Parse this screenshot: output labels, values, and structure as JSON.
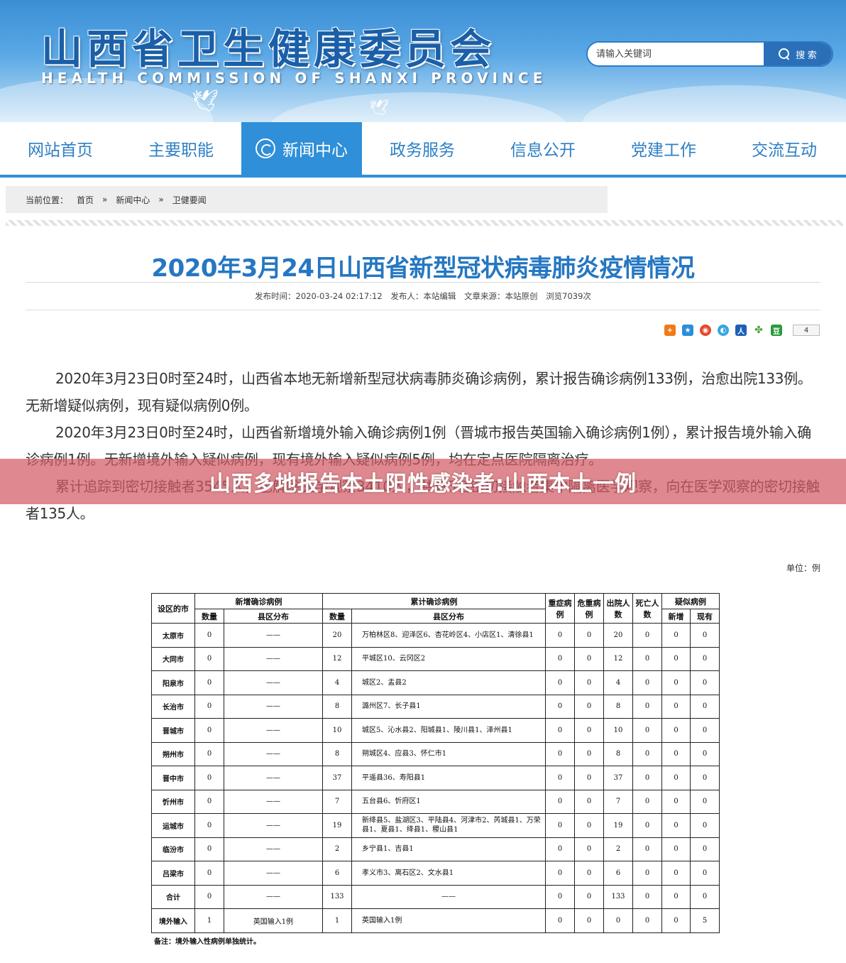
{
  "header": {
    "title": "山西省卫生健康委员会",
    "subtitle": "HEALTH COMMISSION OF SHANXI PROVINCE",
    "search_placeholder": "请输入关键词",
    "search_button": "搜 索"
  },
  "nav": [
    {
      "label": "网站首页",
      "active": false
    },
    {
      "label": "主要职能",
      "active": false
    },
    {
      "label": "新闻中心",
      "active": true
    },
    {
      "label": "政务服务",
      "active": false
    },
    {
      "label": "信息公开",
      "active": false
    },
    {
      "label": "党建工作",
      "active": false
    },
    {
      "label": "交流互动",
      "active": false
    }
  ],
  "breadcrumb": {
    "prefix": "当前位置：",
    "items": [
      "首页",
      "新闻中心",
      "卫健要闻"
    ],
    "sep": "»"
  },
  "article": {
    "title": "2020年3月24日山西省新型冠状病毒肺炎疫情情况",
    "meta": {
      "publish_time": "发布时间：2020-03-24 02:17:12",
      "publisher": "发布人：本站编辑",
      "source": "文章来源：本站原创",
      "views": "浏览7039次"
    },
    "share_count": "4",
    "paragraphs": [
      "2020年3月23日0时至24时，山西省本地无新增新型冠状病毒肺炎确诊病例，累计报告确诊病例133例，治愈出院133例。无新增疑似病例，现有疑似病例0例。",
      "2020年3月23日0时至24时，山西省新增境外输入确诊病例1例（晋城市报告英国输入确诊病例1例），累计报告境外输入确诊病例1例。无新增境外输入疑似病例，现有境外输入疑似病例5例，均在定点医院隔离治疗。",
      "累计追踪到密切接触者3545人，已解除医学观察3410人，共有3名密切接触者集中隔离医学观察，向在医学观察的密切接触者135人。"
    ],
    "unit": "单位：例"
  },
  "banner": "山西多地报告本土阳性感染者:山西本土一例",
  "table": {
    "headers": {
      "city": "设区的市",
      "new_group": "新增确诊病例",
      "cum_group": "累计确诊病例",
      "count": "数量",
      "dist": "县区分布",
      "severe": "重症病例",
      "critical": "危重病例",
      "discharged": "出院人数",
      "death": "死亡人数",
      "suspect_group": "疑似病例",
      "suspect_new": "新增",
      "suspect_now": "现有"
    },
    "rows": [
      {
        "city": "太原市",
        "new": "0",
        "new_dist": "——",
        "cum": "20",
        "cum_dist": "万柏林区8、迎泽区6、杏花岭区4、小店区1、清徐县1",
        "severe": "0",
        "critical": "0",
        "discharged": "20",
        "death": "0",
        "s_new": "0",
        "s_now": "0"
      },
      {
        "city": "大同市",
        "new": "0",
        "new_dist": "——",
        "cum": "12",
        "cum_dist": "平城区10、云冈区2",
        "severe": "0",
        "critical": "0",
        "discharged": "12",
        "death": "0",
        "s_new": "0",
        "s_now": "0"
      },
      {
        "city": "阳泉市",
        "new": "0",
        "new_dist": "——",
        "cum": "4",
        "cum_dist": "城区2、盂县2",
        "severe": "0",
        "critical": "0",
        "discharged": "4",
        "death": "0",
        "s_new": "0",
        "s_now": "0"
      },
      {
        "city": "长治市",
        "new": "0",
        "new_dist": "——",
        "cum": "8",
        "cum_dist": "潞州区7、长子县1",
        "severe": "0",
        "critical": "0",
        "discharged": "8",
        "death": "0",
        "s_new": "0",
        "s_now": "0"
      },
      {
        "city": "晋城市",
        "new": "0",
        "new_dist": "——",
        "cum": "10",
        "cum_dist": "城区5、沁水县2、阳城县1、陵川县1、泽州县1",
        "severe": "0",
        "critical": "0",
        "discharged": "10",
        "death": "0",
        "s_new": "0",
        "s_now": "0"
      },
      {
        "city": "朔州市",
        "new": "0",
        "new_dist": "——",
        "cum": "8",
        "cum_dist": "朔城区4、应县3、怀仁市1",
        "severe": "0",
        "critical": "0",
        "discharged": "8",
        "death": "0",
        "s_new": "0",
        "s_now": "0"
      },
      {
        "city": "晋中市",
        "new": "0",
        "new_dist": "——",
        "cum": "37",
        "cum_dist": "平遥县36、寿阳县1",
        "severe": "0",
        "critical": "0",
        "discharged": "37",
        "death": "0",
        "s_new": "0",
        "s_now": "0"
      },
      {
        "city": "忻州市",
        "new": "0",
        "new_dist": "——",
        "cum": "7",
        "cum_dist": "五台县6、忻府区1",
        "severe": "0",
        "critical": "0",
        "discharged": "7",
        "death": "0",
        "s_new": "0",
        "s_now": "0"
      },
      {
        "city": "运城市",
        "new": "0",
        "new_dist": "——",
        "cum": "19",
        "cum_dist": "新绛县5、盐湖区3、平陆县4、河津市2、芮城县1、万荣县1、夏县1、绛县1、稷山县1",
        "severe": "0",
        "critical": "0",
        "discharged": "19",
        "death": "0",
        "s_new": "0",
        "s_now": "0"
      },
      {
        "city": "临汾市",
        "new": "0",
        "new_dist": "——",
        "cum": "2",
        "cum_dist": "乡宁县1、吉县1",
        "severe": "0",
        "critical": "0",
        "discharged": "2",
        "death": "0",
        "s_new": "0",
        "s_now": "0"
      },
      {
        "city": "吕梁市",
        "new": "0",
        "new_dist": "——",
        "cum": "6",
        "cum_dist": "孝义市3、离石区2、文水县1",
        "severe": "0",
        "critical": "0",
        "discharged": "6",
        "death": "0",
        "s_new": "0",
        "s_now": "0"
      },
      {
        "city": "合计",
        "new": "0",
        "new_dist": "——",
        "cum": "133",
        "cum_dist": "——",
        "severe": "0",
        "critical": "0",
        "discharged": "133",
        "death": "0",
        "s_new": "0",
        "s_now": "0"
      },
      {
        "city": "境外输入",
        "new": "1",
        "new_dist": "英国输入1例",
        "cum": "1",
        "cum_dist": "英国输入1例",
        "severe": "0",
        "critical": "0",
        "discharged": "0",
        "death": "0",
        "s_new": "0",
        "s_now": "5"
      }
    ],
    "footnote": "备注：境外输入性病例单独统计。"
  }
}
